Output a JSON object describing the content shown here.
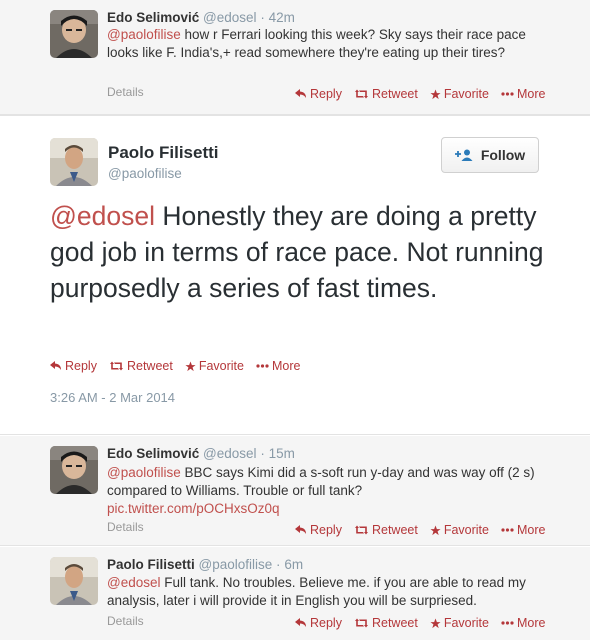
{
  "colors": {
    "accent": "#b4373a",
    "muted": "#8899a6",
    "bg_alt": "#f5f5f5"
  },
  "tweets_above": [
    {
      "name": "Edo Selimović",
      "handle": "@edosel",
      "time": "42m",
      "mention": "@paolofilise",
      "text": " how r Ferrari looking this week? Sky says their race pace looks like F. India's,+ read somewhere they're eating up their tires?",
      "details": "Details"
    }
  ],
  "main_tweet": {
    "name": "Paolo Filisetti",
    "handle": "@paolofilise",
    "follow_label": "Follow",
    "mention": "@edosel",
    "text": " Honestly they are  doing a pretty god  job in terms of  race pace. Not running  purposedly   a series of fast times.",
    "timestamp": "3:26 AM - 2 Mar 2014"
  },
  "replies": [
    {
      "name": "Edo Selimović",
      "handle": "@edosel",
      "time": "15m",
      "mention": "@paolofilise",
      "text": " BBC says Kimi did a s-soft run y-day and was way off (2 s) compared to Williams. Trouble or full tank?",
      "link": "pic.twitter.com/pOCHxsOz0q",
      "details": "Details"
    },
    {
      "name": "Paolo Filisetti",
      "handle": "@paolofilise",
      "time": "6m",
      "mention": "@edosel",
      "text": " Full tank. No troubles. Believe me. if you are able to read my analysis, later i will provide it in English you will be surpriesed.",
      "details": "Details"
    }
  ],
  "actions": {
    "reply": "Reply",
    "retweet": "Retweet",
    "favorite": "Favorite",
    "more": "More"
  },
  "icons": {
    "reply": "reply-arrow-icon",
    "retweet": "retweet-icon",
    "favorite": "star-icon",
    "more": "ellipsis-icon",
    "follow": "add-user-icon"
  }
}
